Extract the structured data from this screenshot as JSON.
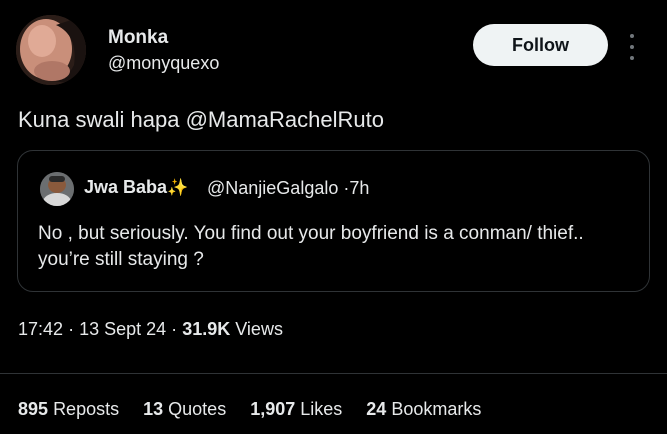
{
  "tweet": {
    "author_name": "Monka",
    "author_handle": "@monyquexo",
    "follow_label": "Follow",
    "text_prefix": "Kuna swali hapa ",
    "text_mention": "@MamaRachelRuto"
  },
  "quote": {
    "author_name": "Jwa Baba",
    "author_emoji": "✨",
    "author_handle": "@NanjieGalgalo",
    "separator": "·",
    "time": "7h",
    "text": "No , but seriously. You find out your boyfriend is a conman/ thief.. you’re still staying ?"
  },
  "meta": {
    "time": "17:42",
    "separator": "·",
    "date": "13 Sept 24",
    "views_count": "31.9K",
    "views_label": "Views"
  },
  "stats": {
    "reposts_count": "895",
    "reposts_label": "Reposts",
    "quotes_count": "13",
    "quotes_label": "Quotes",
    "likes_count": "1,907",
    "likes_label": "Likes",
    "bookmarks_count": "24",
    "bookmarks_label": "Bookmarks"
  }
}
